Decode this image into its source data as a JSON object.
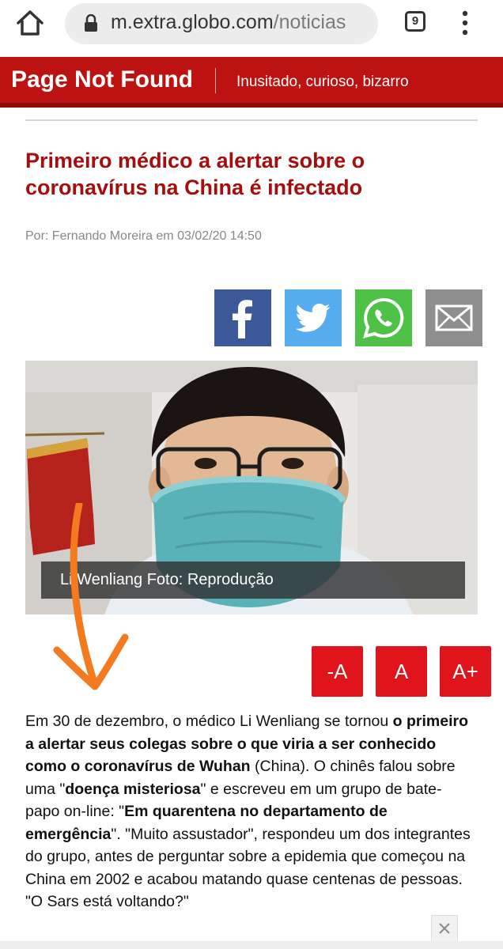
{
  "browser": {
    "url_host": "m.extra.globo.com",
    "url_path": "/noticias",
    "tab_count": "9"
  },
  "site": {
    "title": "Page Not Found",
    "tagline": "Inusitado, curioso, bizarro",
    "brand_color": "#bc1212"
  },
  "article": {
    "headline": "Primeiro médico a alertar sobre o coronavírus na China é infectado",
    "byline": "Por: Fernando Moreira em 03/02/20 14:50",
    "photo_caption": "Li Wenliang Foto: Reprodução",
    "body_segments": [
      {
        "text": "Em 30 de dezembro, o médico Li Wenliang se tornou ",
        "bold": false
      },
      {
        "text": "o primeiro a alertar seus colegas sobre o que viria a ser conhecido como o coronavírus de Wuhan",
        "bold": true
      },
      {
        "text": " (China). O chinês falou sobre uma \"",
        "bold": false
      },
      {
        "text": "doença misteriosa",
        "bold": true
      },
      {
        "text": "\" e escreveu em um grupo de bate-papo on-line: \"",
        "bold": false
      },
      {
        "text": "Em quarentena no departamento de emergência",
        "bold": true
      },
      {
        "text": "\". \"Muito assustador\", respondeu um dos integrantes do grupo, antes de perguntar sobre a epidemia que começou na China em 2002 e acabou matando quase centenas de pessoas. \"O Sars está voltando?\"",
        "bold": false
      }
    ]
  },
  "share": {
    "icons": [
      "facebook-icon",
      "twitter-icon",
      "whatsapp-icon",
      "mail-icon"
    ],
    "colors": {
      "facebook": "#3b5998",
      "twitter": "#55acee",
      "whatsapp": "#4dc247",
      "mail": "#8e8e8e"
    }
  },
  "font_controls": {
    "decrease": "-A",
    "normal": "A",
    "increase": "A+"
  },
  "annotation": {
    "arrow_color": "#f47a20"
  }
}
